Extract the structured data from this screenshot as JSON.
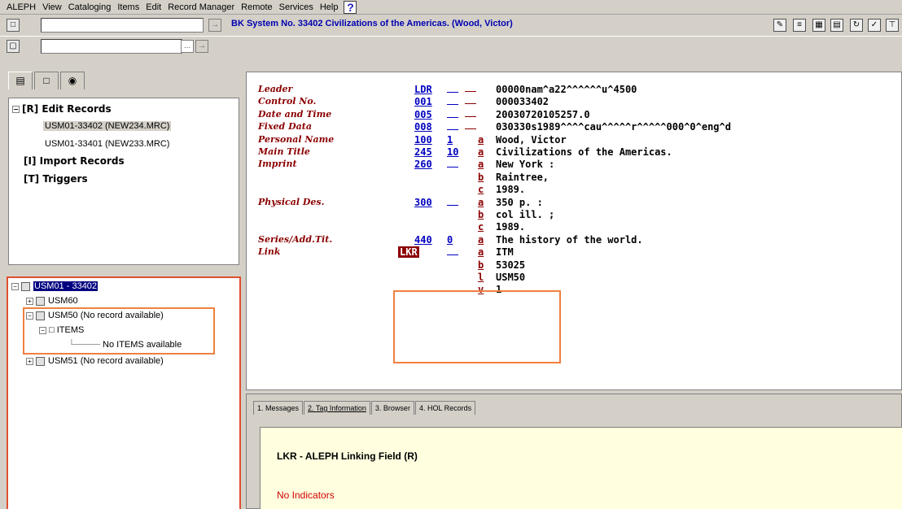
{
  "menu": [
    "ALEPH",
    "View",
    "Cataloging",
    "Items",
    "Edit",
    "Record Manager",
    "Remote",
    "Services",
    "Help"
  ],
  "toolbar": {
    "record_title": "BK System No. 33402 Civilizations of the Americas. (Wood, Victor)",
    "arrow_glyph": "→",
    "browse_glyph": "..."
  },
  "left_tree_top": {
    "edit_records": "[R] Edit Records",
    "records": [
      "USM01-33402 (NEW234.MRC)",
      "USM01-33401 (NEW233.MRC)"
    ],
    "import_records": "[I] Import Records",
    "triggers": "[T] Triggers"
  },
  "left_tree_bottom": {
    "root": "USM01 - 33402",
    "usm60": "USM60",
    "usm50": "USM50 (No record available)",
    "items": "ITEMS",
    "no_items": "No ITEMS available",
    "usm51": "USM51 (No record available)"
  },
  "record": [
    {
      "name": "Leader",
      "tag": "LDR",
      "ind": "",
      "sub": "",
      "value": "00000nam^a22^^^^^^u^4500"
    },
    {
      "name": "Control No.",
      "tag": "001",
      "ind": "",
      "sub": "",
      "value": "000033402"
    },
    {
      "name": "Date and Time",
      "tag": "005",
      "ind": "",
      "sub": "",
      "value": "20030720105257.0"
    },
    {
      "name": "Fixed Data",
      "tag": "008",
      "ind": "",
      "sub": "",
      "value": "030330s1989^^^^cau^^^^^r^^^^^000^0^eng^d"
    },
    {
      "name": "Personal Name",
      "tag": "100",
      "ind": "1",
      "sub": "a",
      "value": "Wood, Victor"
    },
    {
      "name": "Main Title",
      "tag": "245",
      "ind": "10",
      "sub": "a",
      "value": "Civilizations of the Americas."
    },
    {
      "name": "Imprint",
      "tag": "260",
      "ind": "",
      "sub": "a",
      "value": "New York :"
    },
    {
      "name": "",
      "tag": "",
      "ind": "",
      "sub": "b",
      "value": "Raintree,"
    },
    {
      "name": "",
      "tag": "",
      "ind": "",
      "sub": "c",
      "value": "1989."
    },
    {
      "name": "Physical Des.",
      "tag": "300",
      "ind": "",
      "sub": "a",
      "value": "350 p. :"
    },
    {
      "name": "",
      "tag": "",
      "ind": "",
      "sub": "b",
      "value": "col ill. ;"
    },
    {
      "name": "",
      "tag": "",
      "ind": "",
      "sub": "c",
      "value": "1989."
    },
    {
      "name": "Series/Add.Tit.",
      "tag": "440",
      "ind": "0",
      "sub": "a",
      "value": "The history of the world."
    },
    {
      "name": "Link",
      "tag": "LKR",
      "ind": "",
      "sub": "a",
      "value": "ITM"
    },
    {
      "name": "",
      "tag": "",
      "ind": "",
      "sub": "b",
      "value": "53025"
    },
    {
      "name": "",
      "tag": "",
      "ind": "",
      "sub": "l",
      "value": "USM50"
    },
    {
      "name": "",
      "tag": "",
      "ind": "",
      "sub": "v",
      "value": "1"
    }
  ],
  "bottom_tabs": [
    "1. Messages",
    "2. Tag Information",
    "3. Browser",
    "4. HOL Records"
  ],
  "tag_info": {
    "title": "LKR - ALEPH Linking Field (R)",
    "subtitle": "No Indicators"
  },
  "colors": {
    "field_name": "#8b0000",
    "tag": "#0000c0",
    "highlight_box": "#f08040"
  }
}
